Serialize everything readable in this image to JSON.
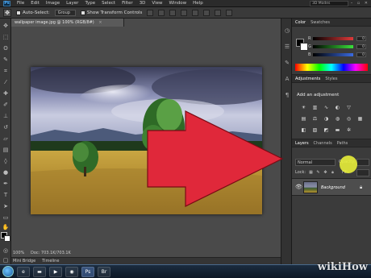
{
  "menubar": {
    "logo": "Ps",
    "items": [
      "File",
      "Edit",
      "Image",
      "Layer",
      "Type",
      "Select",
      "Filter",
      "3D",
      "View",
      "Window",
      "Help"
    ],
    "workspace_box": "3D Modes",
    "window_controls": "– ▫ ✕"
  },
  "options_bar": {
    "auto_select_label": "Auto-Select:",
    "auto_select_value": "Group",
    "show_transform_label": "Show Transform Controls"
  },
  "document": {
    "tab_title": "wallpaper image.jpg @ 100% (RGB/8#)",
    "tab_close": "×",
    "zoom": "100%",
    "doc_info": "Doc: 703.1K/703.1K"
  },
  "bottom_tabs": [
    "Mini Bridge",
    "Timeline"
  ],
  "panels": {
    "color_tabs": [
      "Color",
      "Swatches"
    ],
    "color_sliders": [
      {
        "label": "R",
        "value": "0",
        "color": "#e03a3a"
      },
      {
        "label": "G",
        "value": "0",
        "color": "#3ae03a"
      },
      {
        "label": "B",
        "value": "0",
        "color": "#3a6ae0"
      }
    ],
    "adjustment_tabs": [
      "Adjustments",
      "Styles"
    ],
    "adjustment_title": "Add an adjustment",
    "layers_tabs": [
      "Layers",
      "Channels",
      "Paths"
    ],
    "blend_mode": "Normal",
    "opacity_label": "Opacity:",
    "lock_label": "Lock:",
    "fill_label": "Fill:",
    "layer_name": "Background"
  },
  "watermark": "wikiHow",
  "colors": {
    "arrow_red": "#e0283a",
    "highlight_yellow": "#e8ee3a"
  }
}
